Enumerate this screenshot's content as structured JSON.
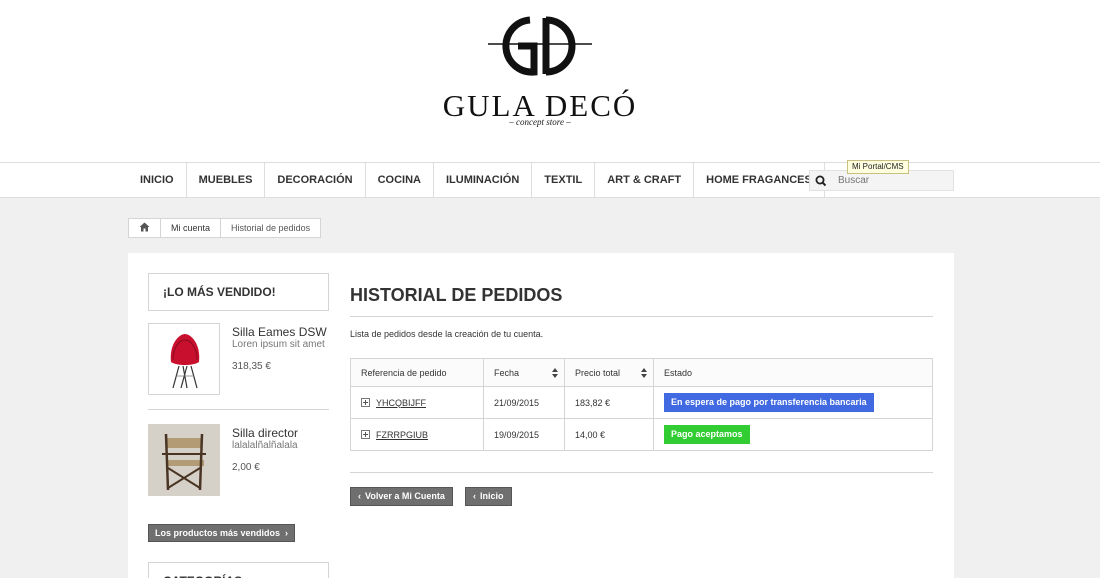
{
  "header": {
    "logo_title": "GULA DECÓ",
    "logo_subtitle": "– concept store –"
  },
  "nav": {
    "items": [
      "INICIO",
      "MUEBLES",
      "DECORACIÓN",
      "COCINA",
      "ILUMINACIÓN",
      "TEXTIL",
      "ART & CRAFT",
      "HOME FRAGANCES"
    ],
    "search_placeholder": "Buscar",
    "tooltip": "Mi Portal/CMS"
  },
  "breadcrumb": {
    "items": [
      "Mi cuenta",
      "Historial de pedidos"
    ]
  },
  "sidebar": {
    "title": "¡LO MÁS VENDIDO!",
    "products": [
      {
        "name": "Silla Eames DSW",
        "desc": "Loren ipsum sit amet",
        "price": "318,35 €"
      },
      {
        "name": "Silla director",
        "desc": "lalalalñalñalala",
        "price": "2,00 €"
      }
    ],
    "best_sellers_button": "Los productos más vendidos",
    "next_title": "CATEGORÍAS"
  },
  "main": {
    "title": "HISTORIAL DE PEDIDOS",
    "intro": "Lista de pedidos desde la creación de tu cuenta.",
    "table": {
      "headers": [
        "Referencia de pedido",
        "Fecha",
        "Precio total",
        "Estado"
      ],
      "rows": [
        {
          "ref": "YHCQBIJFF",
          "date": "21/09/2015",
          "total": "183,82 €",
          "status": "En espera de pago por transferencia bancaria",
          "status_color": "#4169e1"
        },
        {
          "ref": "FZRRPGIUB",
          "date": "19/09/2015",
          "total": "14,00 €",
          "status": "Pago aceptamos",
          "status_color": "#32cd32"
        }
      ]
    },
    "back_button": "Volver a Mi Cuenta",
    "home_button": "Inicio"
  }
}
